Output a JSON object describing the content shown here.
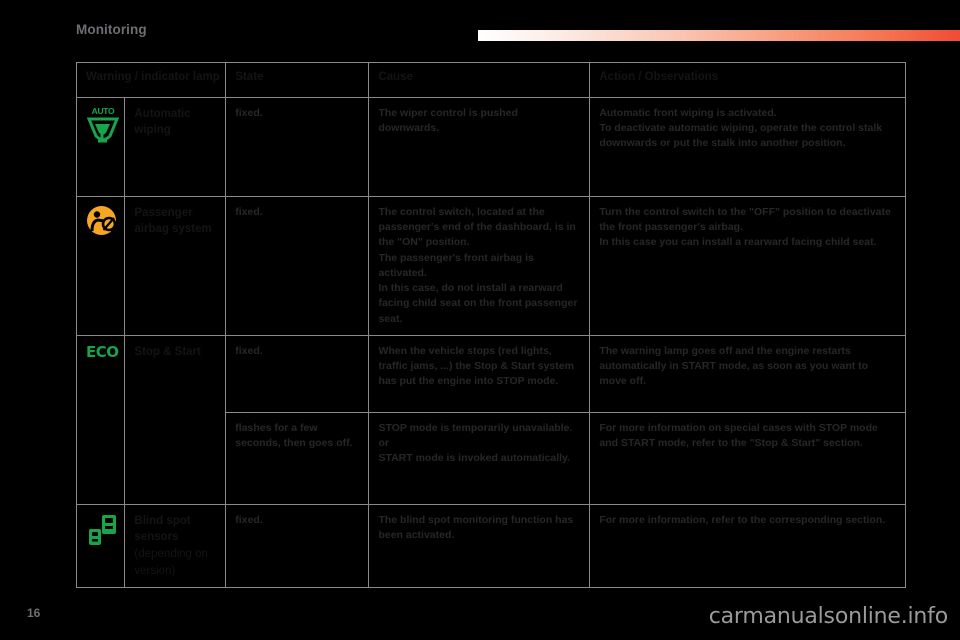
{
  "header": {
    "section_title": "Monitoring",
    "accent_gradient_from": "#ffffff",
    "accent_gradient_to": "#f04b36"
  },
  "table": {
    "columns": [
      {
        "key": "lamp",
        "label": "Warning / indicator lamp"
      },
      {
        "key": "state",
        "label": "State"
      },
      {
        "key": "cause",
        "label": "Cause"
      },
      {
        "key": "action",
        "label": "Action / Observations"
      }
    ],
    "rows": [
      {
        "icon": "auto-wiper-icon",
        "icon_color": "#17a44a",
        "icon_text": "AUTO",
        "label": "Automatic wiping",
        "label_sub": "",
        "state": "fixed.",
        "cause": "The wiper control is pushed downwards.",
        "action": "Automatic front wiping is activated.\nTo deactivate automatic wiping, operate the control stalk downwards or put the stalk into another position."
      },
      {
        "icon": "passenger-airbag-icon",
        "icon_color": "#f5a623",
        "icon_text": "",
        "label": "Passenger airbag system",
        "label_sub": "",
        "state": "fixed.",
        "cause": "The control switch, located at the passenger's end of the dashboard, is in the \"ON\" position.\nThe passenger's front airbag is activated.\nIn this case, do not install a rearward facing child seat on the front passenger seat.",
        "action": "Turn the control switch to the \"OFF\" position to deactivate the front passenger's airbag.\nIn this case you can install a rearward facing child seat."
      },
      {
        "icon": "eco-icon",
        "icon_color": "#17a44a",
        "icon_text": "ECO",
        "label": "Stop & Start",
        "label_sub": "",
        "state": "fixed.",
        "cause": "When the vehicle stops (red lights, traffic jams, ...) the Stop & Start system has put the engine into STOP mode.",
        "action": "The warning lamp goes off and the engine restarts automatically in START mode, as soon as you want to move off.",
        "sub_row": {
          "state": "flashes for a few seconds, then goes off.",
          "cause": "STOP mode is temporarily unavailable.\nor\nSTART mode is invoked automatically.",
          "action": "For more information on special cases with STOP mode and START mode, refer to the \"Stop & Start\" section."
        }
      },
      {
        "icon": "blind-spot-icon",
        "icon_color": "#17a44a",
        "icon_text": "",
        "label": "Blind spot sensors",
        "label_sub": "(depending on version)",
        "state": "fixed.",
        "cause": "The blind spot monitoring function has been activated.",
        "action": "For more information, refer to the corresponding section."
      }
    ]
  },
  "footer": {
    "page_number": "16",
    "watermark": "carmanualsonline.info"
  }
}
